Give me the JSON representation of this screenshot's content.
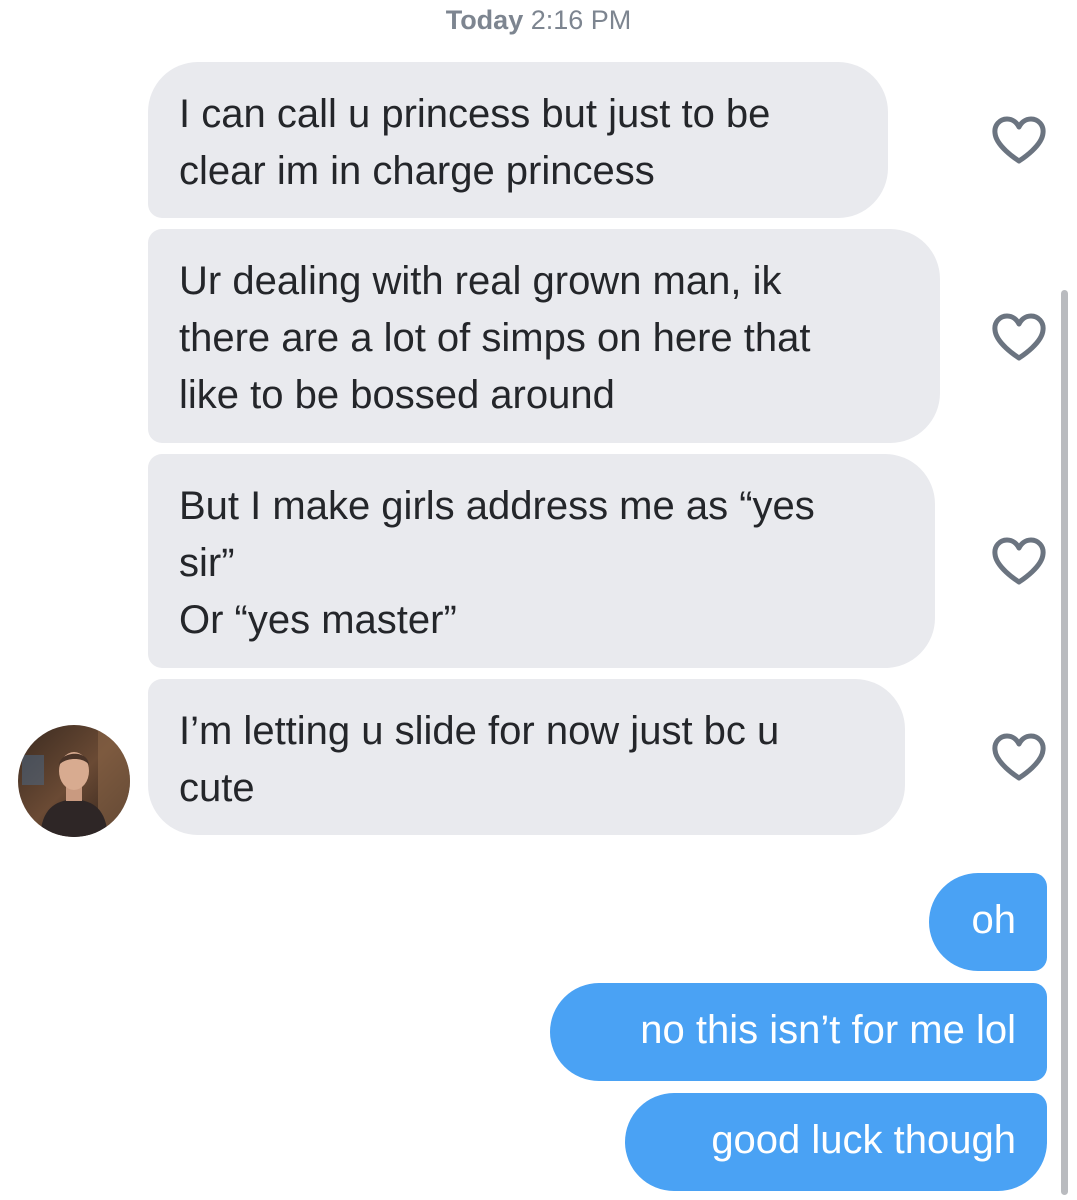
{
  "header": {
    "day": "Today",
    "time": "2:16 PM"
  },
  "incoming_messages": [
    {
      "text": "I can call u princess but just to be\nclear im in charge princess",
      "liked": false
    },
    {
      "text": "Ur dealing with real grown man, ik\nthere are a lot of simps on here that\nlike to be bossed around",
      "liked": false
    },
    {
      "text": "But I make girls address me as “yes\nsir”\nOr “yes master”",
      "liked": false
    },
    {
      "text": "I’m letting u slide for now just bc u\ncute",
      "liked": false
    }
  ],
  "outgoing_messages": [
    {
      "text": "oh"
    },
    {
      "text": "no this isn’t for me lol"
    },
    {
      "text": "good luck though"
    }
  ],
  "icons": {
    "like": "heart-outline-icon",
    "avatar": "contact-avatar"
  },
  "colors": {
    "incoming_bubble": "#e9eaee",
    "incoming_text": "#24262a",
    "outgoing_bubble": "#4aa2f4",
    "outgoing_text": "#ffffff",
    "timestamp": "#7d8590",
    "like_icon": "#6b7480"
  }
}
